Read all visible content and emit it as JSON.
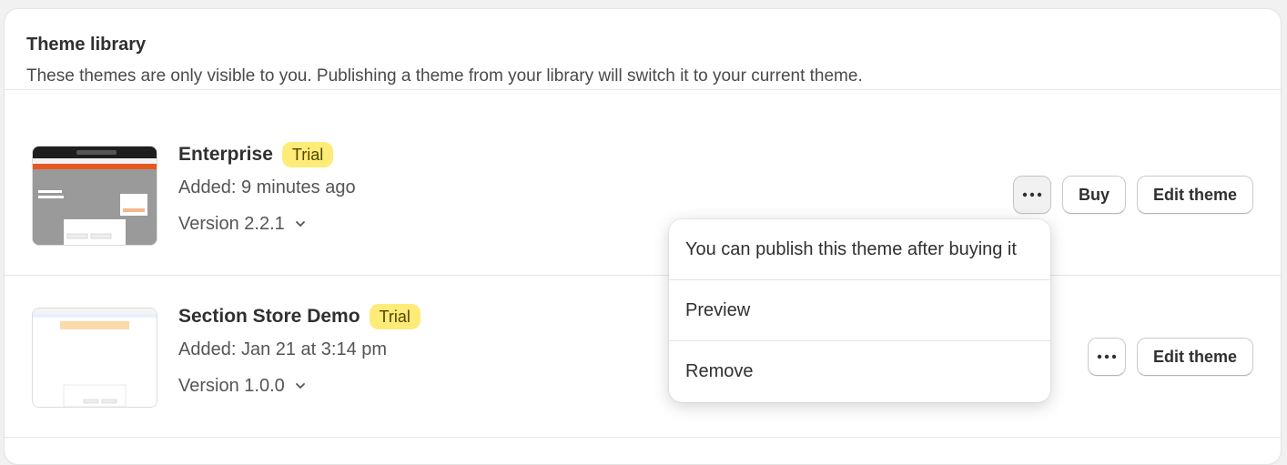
{
  "library": {
    "title": "Theme library",
    "subtitle": "These themes are only visible to you. Publishing a theme from your library will switch it to your current theme."
  },
  "themes": [
    {
      "name": "Enterprise",
      "badge": "Trial",
      "added": "Added: 9 minutes ago",
      "version": "Version 2.2.1",
      "actions": {
        "buy": "Buy",
        "edit": "Edit theme"
      }
    },
    {
      "name": "Section Store Demo",
      "badge": "Trial",
      "added": "Added: Jan 21 at 3:14 pm",
      "version": "Version 1.0.0",
      "actions": {
        "edit": "Edit theme"
      }
    }
  ],
  "menu": {
    "items": [
      "You can publish this theme after buying it",
      "Preview",
      "Remove"
    ]
  },
  "colors": {
    "badge_bg": "#ffeb78",
    "badge_text": "#4f4700"
  },
  "icons": {
    "more": "horizontal-dots-icon",
    "chevron": "chevron-down-icon"
  }
}
